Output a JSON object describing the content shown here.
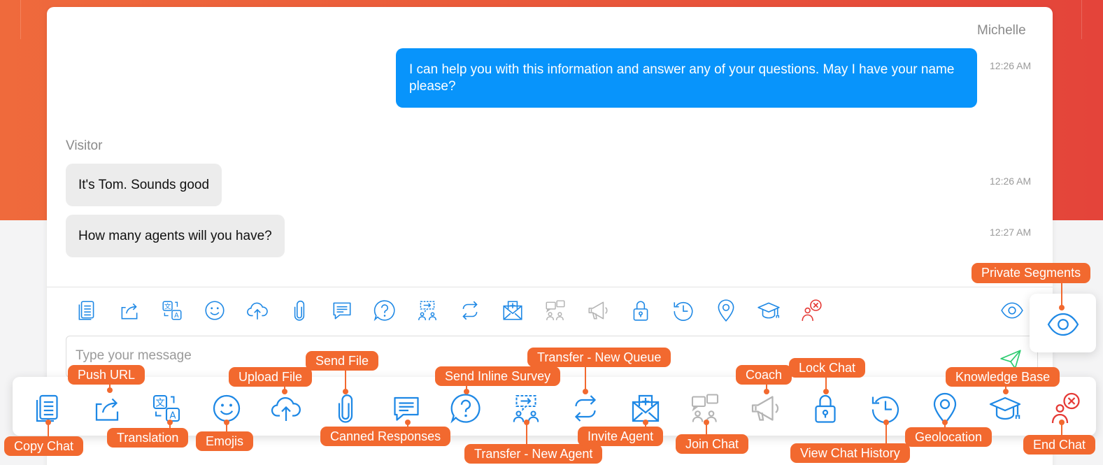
{
  "conversation": {
    "agent_name": "Michelle",
    "agent_message": "I can help you with this information and answer any of your questions. May I have your name please?",
    "agent_time": "12:26 AM",
    "visitor_name": "Visitor",
    "visitor_messages": [
      {
        "text": "It's Tom. Sounds good",
        "time": "12:26 AM"
      },
      {
        "text": "How many agents will you have?",
        "time": "12:27 AM"
      }
    ]
  },
  "composer": {
    "placeholder": "Type your message"
  },
  "toolbar_icons": [
    "copy-chat-icon",
    "push-url-icon",
    "translation-icon",
    "emoji-icon",
    "upload-file-icon",
    "paperclip-icon",
    "canned-responses-icon",
    "inline-survey-icon",
    "transfer-new-agent-icon",
    "transfer-new-queue-icon",
    "invite-agent-icon",
    "join-chat-icon",
    "coach-icon",
    "lock-chat-icon",
    "history-icon",
    "geolocation-icon",
    "knowledge-base-icon",
    "end-chat-icon",
    "eye-icon"
  ],
  "callouts": {
    "private_segments": "Private Segments",
    "push_url": "Push URL",
    "upload_file": "Upload File",
    "send_file": "Send File",
    "send_inline_survey": "Send Inline Survey",
    "transfer_new_queue": "Transfer - New Queue",
    "coach": "Coach",
    "lock_chat": "Lock Chat",
    "knowledge_base": "Knowledge Base",
    "copy_chat": "Copy Chat",
    "translation": "Translation",
    "emojis": "Emojis",
    "canned_responses": "Canned Responses",
    "transfer_new_agent": "Transfer - New Agent",
    "invite_agent": "Invite Agent",
    "join_chat": "Join Chat",
    "view_chat_history": "View Chat History",
    "geolocation": "Geolocation",
    "end_chat": "End Chat"
  },
  "colors": {
    "primary_blue": "#1e88e5",
    "agent_bubble": "#0894fb",
    "accent_orange": "#f2692f",
    "end_chat_red": "#e53935",
    "disabled_gray": "#b4b4b4",
    "send_green": "#2ecc71"
  }
}
